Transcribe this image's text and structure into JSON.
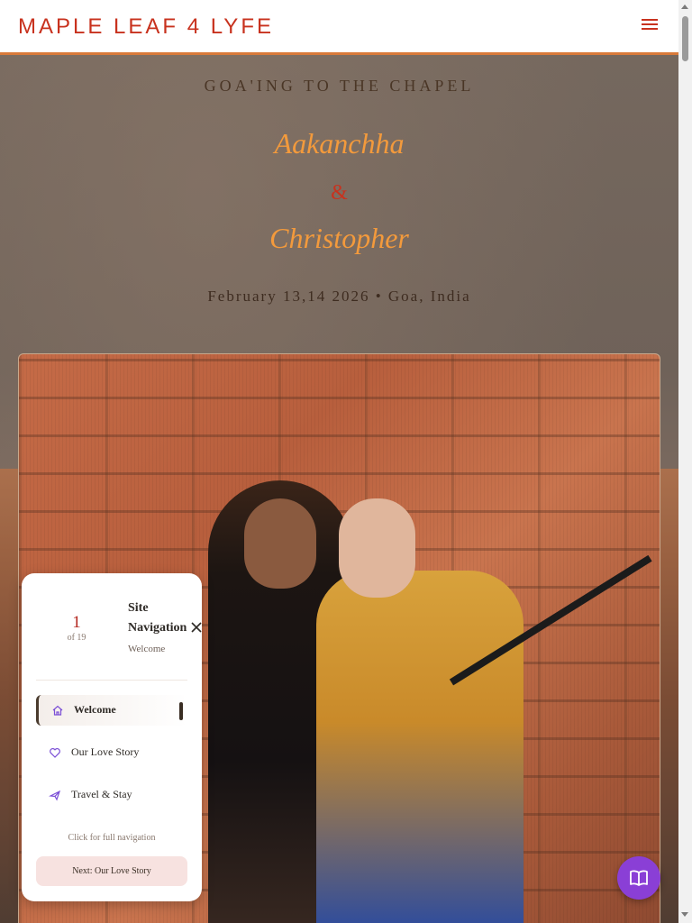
{
  "header": {
    "brand": "MAPLE LEAF 4 LYFE"
  },
  "hero": {
    "tagline": "GOA'ING TO THE CHAPEL",
    "name1": "Aakanchha",
    "ampersand": "&",
    "name2": "Christopher",
    "dateline": "February 13,14 2026 • Goa, India"
  },
  "nav_panel": {
    "current_page": "1",
    "total_label": "of 19",
    "title": "Site Navigation",
    "subtitle": "Welcome",
    "items": [
      {
        "label": "Welcome",
        "icon": "home-icon",
        "active": true
      },
      {
        "label": "Our Love Story",
        "icon": "heart-icon",
        "active": false
      },
      {
        "label": "Travel & Stay",
        "icon": "plane-icon",
        "active": false
      }
    ],
    "footnote": "Click for full navigation",
    "next_label": "Next: Our Love Story"
  },
  "colors": {
    "brand_red": "#c8321e",
    "accent_orange": "#f39a3c",
    "header_border": "#d97a3a",
    "fab_purple": "#8a3fd6",
    "icon_purple": "#7b4fd6"
  },
  "icons": {
    "menu": "hamburger-menu-icon",
    "close": "close-icon",
    "book": "open-book-icon"
  }
}
